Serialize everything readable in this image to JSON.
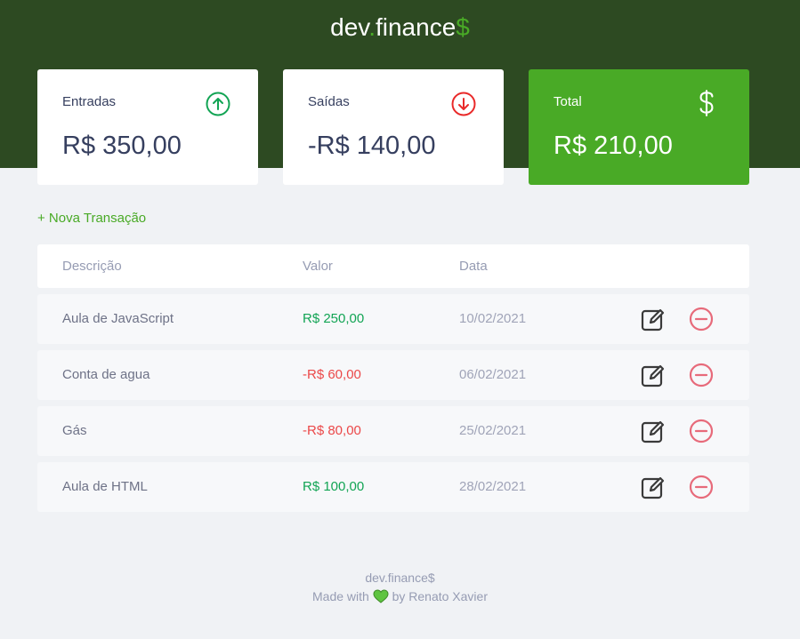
{
  "app": {
    "logo_main": "dev",
    "logo_dot": ".",
    "logo_finance": "finance",
    "logo_dollar": "$"
  },
  "cards": {
    "income": {
      "label": "Entradas",
      "value": "R$ 350,00",
      "icon": "arrow-up-circle-icon",
      "color": "#12a454"
    },
    "expense": {
      "label": "Saídas",
      "value": "-R$ 140,00",
      "icon": "arrow-down-circle-icon",
      "color": "#e92929"
    },
    "total": {
      "label": "Total",
      "value": "R$ 210,00",
      "icon": "dollar-icon",
      "color": "#49aa26"
    }
  },
  "new_transaction_label": "+ Nova Transação",
  "table": {
    "headers": [
      "Descrição",
      "Valor",
      "Data"
    ],
    "rows": [
      {
        "description": "Aula de JavaScript",
        "amount": "R$ 250,00",
        "type": "income",
        "date": "10/02/2021"
      },
      {
        "description": "Conta de agua",
        "amount": "-R$ 60,00",
        "type": "expense",
        "date": "06/02/2021"
      },
      {
        "description": "Gás",
        "amount": "-R$ 80,00",
        "type": "expense",
        "date": "25/02/2021"
      },
      {
        "description": "Aula de HTML",
        "amount": "R$ 100,00",
        "type": "income",
        "date": "28/02/2021"
      }
    ]
  },
  "footer": {
    "brand": "dev.finance$",
    "made_with": "Made with",
    "by": "by Renato Xavier"
  },
  "colors": {
    "header_bg": "#2d4a22",
    "accent_green": "#49aa26",
    "income": "#12a454",
    "expense": "#e92929",
    "page_bg": "#f0f2f5"
  }
}
